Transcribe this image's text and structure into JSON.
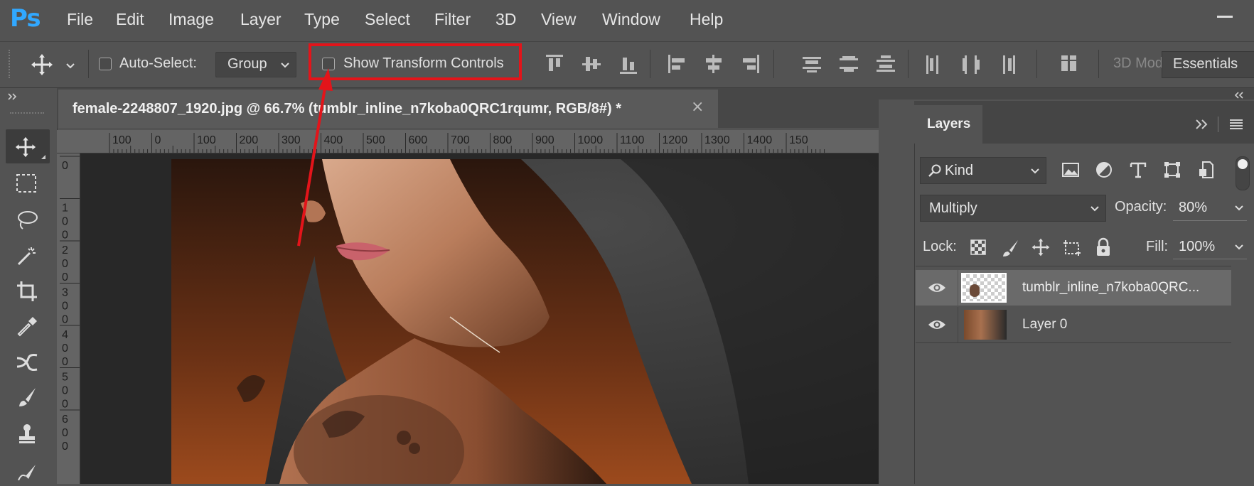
{
  "app": {
    "logo": "Ps",
    "menu": [
      "File",
      "Edit",
      "Image",
      "Layer",
      "Type",
      "Select",
      "Filter",
      "3D",
      "View",
      "Window",
      "Help"
    ]
  },
  "options_bar": {
    "move_icon": "move-icon",
    "auto_select_label": "Auto-Select:",
    "auto_select_checked": false,
    "group_value": "Group",
    "show_transform_label": "Show Transform Controls",
    "show_transform_checked": false,
    "mode_3d_label": "3D Mod",
    "workspace": "Essentials"
  },
  "document": {
    "tab_title": "female-2248807_1920.jpg @ 66.7% (tumblr_inline_n7koba0QRC1rqumr, RGB/8#) *",
    "close_glyph": "×",
    "ruler_h": [
      "100",
      "0",
      "100",
      "200",
      "300",
      "400",
      "500",
      "600",
      "700",
      "800",
      "900",
      "1000",
      "1100",
      "1200",
      "1300",
      "1400",
      "150"
    ],
    "ruler_v": [
      [
        "0"
      ],
      [
        "1",
        "0",
        "0"
      ],
      [
        "2",
        "0",
        "0"
      ],
      [
        "3",
        "0",
        "0"
      ],
      [
        "4",
        "0",
        "0"
      ],
      [
        "5",
        "0",
        "0"
      ],
      [
        "6",
        "0",
        "0"
      ]
    ]
  },
  "layers_panel": {
    "tab_label": "Layers",
    "filter_kind": "Kind",
    "blend_mode": "Multiply",
    "opacity_label": "Opacity:",
    "opacity_value": "80%",
    "lock_label": "Lock:",
    "fill_label": "Fill:",
    "fill_value": "100%",
    "layers": [
      {
        "name": "tumblr_inline_n7koba0QRC...",
        "visible": true,
        "selected": true
      },
      {
        "name": "Layer 0",
        "visible": true,
        "selected": false
      }
    ]
  },
  "colors": {
    "accent_red": "#e3141a",
    "ps_blue": "#31a8ff"
  }
}
